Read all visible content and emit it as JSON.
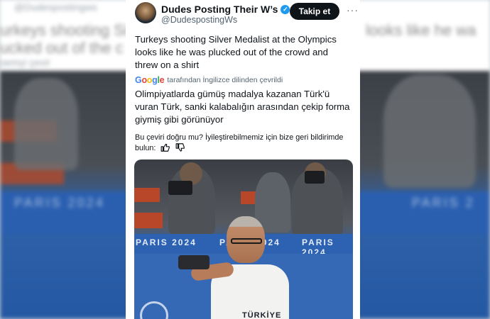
{
  "background": {
    "ghost_line_1": "@Dudespostingws",
    "ghost_line_2": "urkeys shooting Si",
    "ghost_line_3": "ucked out of the c",
    "ghost_line_4": "oemyi çevir",
    "ghost_right_1": "looks like he wa",
    "band_text_left": "PARIS 2024",
    "band_text_right": "PARIS 2"
  },
  "tweet": {
    "display_name": "Dudes Posting Their W’s",
    "handle": "@DudespostingWs",
    "follow_label": "Takip et",
    "more_label": "···",
    "text": "Turkeys shooting Silver Medalist at the Olympics looks like he was plucked out of the crowd and threw on a shirt",
    "translated_by": "tarafından İngilizce dilinden çevrildi",
    "google_letters": [
      "G",
      "o",
      "o",
      "g",
      "l",
      "e"
    ],
    "translation": "Olimpiyatlarda gümüş madalya kazanan Türk'ü vuran Türk, sanki kalabalığın arasından çekip forma giymiş gibi görünüyor",
    "feedback_prompt": "Bu çeviri doğru mu? İyileştirebilmemiz için bize geri bildirimde bulun:"
  },
  "media": {
    "band_text_1": "PARIS 2024",
    "band_text_2": "PARIS 2024",
    "band_text_3": "PARIS 2024",
    "shirt_text": "TÜRKİYE"
  },
  "colors": {
    "accent": "#1d9bf0",
    "follow_button_bg": "#0f1419",
    "muted_text": "#536471"
  },
  "icons": [
    "verified-badge-icon",
    "affiliate-icon",
    "more-icon",
    "google-logo",
    "thumbs-up-icon",
    "thumbs-down-icon"
  ]
}
